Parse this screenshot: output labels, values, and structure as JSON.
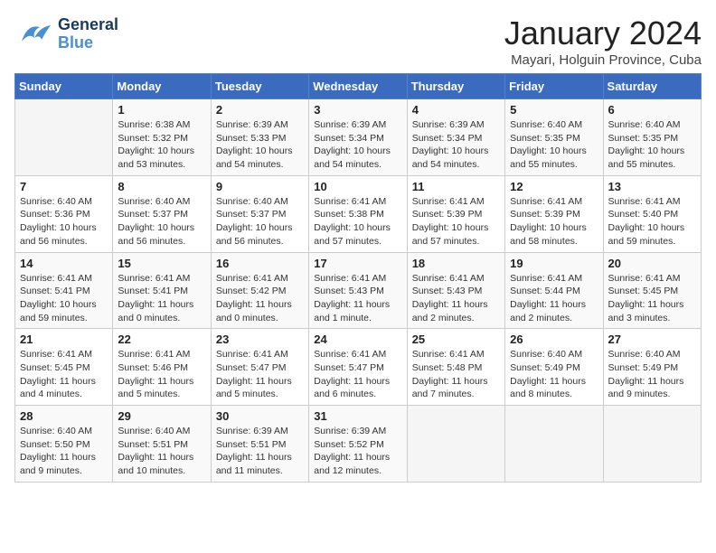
{
  "header": {
    "logo_general": "General",
    "logo_blue": "Blue",
    "month_title": "January 2024",
    "location": "Mayari, Holguin Province, Cuba"
  },
  "days_of_week": [
    "Sunday",
    "Monday",
    "Tuesday",
    "Wednesday",
    "Thursday",
    "Friday",
    "Saturday"
  ],
  "weeks": [
    [
      {
        "day": "",
        "info": ""
      },
      {
        "day": "1",
        "info": "Sunrise: 6:38 AM\nSunset: 5:32 PM\nDaylight: 10 hours\nand 53 minutes."
      },
      {
        "day": "2",
        "info": "Sunrise: 6:39 AM\nSunset: 5:33 PM\nDaylight: 10 hours\nand 54 minutes."
      },
      {
        "day": "3",
        "info": "Sunrise: 6:39 AM\nSunset: 5:34 PM\nDaylight: 10 hours\nand 54 minutes."
      },
      {
        "day": "4",
        "info": "Sunrise: 6:39 AM\nSunset: 5:34 PM\nDaylight: 10 hours\nand 54 minutes."
      },
      {
        "day": "5",
        "info": "Sunrise: 6:40 AM\nSunset: 5:35 PM\nDaylight: 10 hours\nand 55 minutes."
      },
      {
        "day": "6",
        "info": "Sunrise: 6:40 AM\nSunset: 5:35 PM\nDaylight: 10 hours\nand 55 minutes."
      }
    ],
    [
      {
        "day": "7",
        "info": "Sunrise: 6:40 AM\nSunset: 5:36 PM\nDaylight: 10 hours\nand 56 minutes."
      },
      {
        "day": "8",
        "info": "Sunrise: 6:40 AM\nSunset: 5:37 PM\nDaylight: 10 hours\nand 56 minutes."
      },
      {
        "day": "9",
        "info": "Sunrise: 6:40 AM\nSunset: 5:37 PM\nDaylight: 10 hours\nand 56 minutes."
      },
      {
        "day": "10",
        "info": "Sunrise: 6:41 AM\nSunset: 5:38 PM\nDaylight: 10 hours\nand 57 minutes."
      },
      {
        "day": "11",
        "info": "Sunrise: 6:41 AM\nSunset: 5:39 PM\nDaylight: 10 hours\nand 57 minutes."
      },
      {
        "day": "12",
        "info": "Sunrise: 6:41 AM\nSunset: 5:39 PM\nDaylight: 10 hours\nand 58 minutes."
      },
      {
        "day": "13",
        "info": "Sunrise: 6:41 AM\nSunset: 5:40 PM\nDaylight: 10 hours\nand 59 minutes."
      }
    ],
    [
      {
        "day": "14",
        "info": "Sunrise: 6:41 AM\nSunset: 5:41 PM\nDaylight: 10 hours\nand 59 minutes."
      },
      {
        "day": "15",
        "info": "Sunrise: 6:41 AM\nSunset: 5:41 PM\nDaylight: 11 hours\nand 0 minutes."
      },
      {
        "day": "16",
        "info": "Sunrise: 6:41 AM\nSunset: 5:42 PM\nDaylight: 11 hours\nand 0 minutes."
      },
      {
        "day": "17",
        "info": "Sunrise: 6:41 AM\nSunset: 5:43 PM\nDaylight: 11 hours\nand 1 minute."
      },
      {
        "day": "18",
        "info": "Sunrise: 6:41 AM\nSunset: 5:43 PM\nDaylight: 11 hours\nand 2 minutes."
      },
      {
        "day": "19",
        "info": "Sunrise: 6:41 AM\nSunset: 5:44 PM\nDaylight: 11 hours\nand 2 minutes."
      },
      {
        "day": "20",
        "info": "Sunrise: 6:41 AM\nSunset: 5:45 PM\nDaylight: 11 hours\nand 3 minutes."
      }
    ],
    [
      {
        "day": "21",
        "info": "Sunrise: 6:41 AM\nSunset: 5:45 PM\nDaylight: 11 hours\nand 4 minutes."
      },
      {
        "day": "22",
        "info": "Sunrise: 6:41 AM\nSunset: 5:46 PM\nDaylight: 11 hours\nand 5 minutes."
      },
      {
        "day": "23",
        "info": "Sunrise: 6:41 AM\nSunset: 5:47 PM\nDaylight: 11 hours\nand 5 minutes."
      },
      {
        "day": "24",
        "info": "Sunrise: 6:41 AM\nSunset: 5:47 PM\nDaylight: 11 hours\nand 6 minutes."
      },
      {
        "day": "25",
        "info": "Sunrise: 6:41 AM\nSunset: 5:48 PM\nDaylight: 11 hours\nand 7 minutes."
      },
      {
        "day": "26",
        "info": "Sunrise: 6:40 AM\nSunset: 5:49 PM\nDaylight: 11 hours\nand 8 minutes."
      },
      {
        "day": "27",
        "info": "Sunrise: 6:40 AM\nSunset: 5:49 PM\nDaylight: 11 hours\nand 9 minutes."
      }
    ],
    [
      {
        "day": "28",
        "info": "Sunrise: 6:40 AM\nSunset: 5:50 PM\nDaylight: 11 hours\nand 9 minutes."
      },
      {
        "day": "29",
        "info": "Sunrise: 6:40 AM\nSunset: 5:51 PM\nDaylight: 11 hours\nand 10 minutes."
      },
      {
        "day": "30",
        "info": "Sunrise: 6:39 AM\nSunset: 5:51 PM\nDaylight: 11 hours\nand 11 minutes."
      },
      {
        "day": "31",
        "info": "Sunrise: 6:39 AM\nSunset: 5:52 PM\nDaylight: 11 hours\nand 12 minutes."
      },
      {
        "day": "",
        "info": ""
      },
      {
        "day": "",
        "info": ""
      },
      {
        "day": "",
        "info": ""
      }
    ]
  ]
}
